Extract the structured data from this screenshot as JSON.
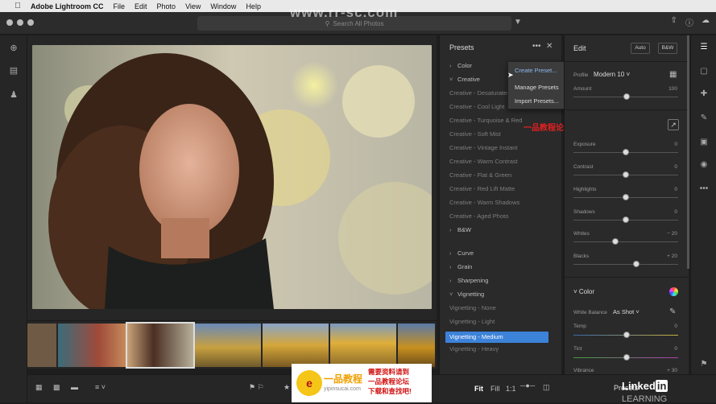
{
  "menubar": {
    "app": "Adobe Lightroom CC",
    "items": [
      "File",
      "Edit",
      "Photo",
      "View",
      "Window",
      "Help"
    ]
  },
  "watermark": "www.rr-sc.com",
  "search": {
    "placeholder": "Search All Photos"
  },
  "presets": {
    "title": "Presets",
    "items": [
      {
        "label": "Color",
        "type": "group",
        "expanded": false
      },
      {
        "label": "Creative",
        "type": "group",
        "expanded": true
      },
      {
        "label": "Creative - Desaturated",
        "type": "preset"
      },
      {
        "label": "Creative - Cool Light",
        "type": "preset"
      },
      {
        "label": "Creative - Turquoise & Red",
        "type": "preset"
      },
      {
        "label": "Creative - Soft Mist",
        "type": "preset"
      },
      {
        "label": "Creative - Vintage Instant",
        "type": "preset"
      },
      {
        "label": "Creative - Warm Contrast",
        "type": "preset"
      },
      {
        "label": "Creative - Flat & Green",
        "type": "preset"
      },
      {
        "label": "Creative - Red Lift Matte",
        "type": "preset"
      },
      {
        "label": "Creative - Warm Shadows",
        "type": "preset"
      },
      {
        "label": "Creative - Aged Photo",
        "type": "preset"
      },
      {
        "label": "B&W",
        "type": "group",
        "expanded": false
      },
      {
        "label": "Curve",
        "type": "group",
        "expanded": false
      },
      {
        "label": "Grain",
        "type": "group",
        "expanded": false
      },
      {
        "label": "Sharpening",
        "type": "group",
        "expanded": false
      },
      {
        "label": "Vignetting",
        "type": "group",
        "expanded": true
      },
      {
        "label": "Vignetting - None",
        "type": "preset"
      },
      {
        "label": "Vignetting - Light",
        "type": "preset"
      },
      {
        "label": "Vignetting - Medium",
        "type": "preset",
        "active": true
      },
      {
        "label": "Vignetting - Heavy",
        "type": "preset"
      }
    ]
  },
  "context_menu": {
    "items": [
      "Create Preset...",
      "Manage Presets",
      "Import Presets..."
    ]
  },
  "annotation": "一品教程论坛首发",
  "edit": {
    "title": "Edit",
    "auto_label": "Auto",
    "bw_label": "B&W",
    "profile_label": "Profile",
    "profile_value": "Modern 10",
    "amount": {
      "label": "Amount",
      "value": "100"
    },
    "sliders": [
      {
        "label": "Exposure",
        "value": "0",
        "pos": 0.5
      },
      {
        "label": "Contrast",
        "value": "0",
        "pos": 0.5
      },
      {
        "label": "Highlights",
        "value": "0",
        "pos": 0.5
      },
      {
        "label": "Shadows",
        "value": "0",
        "pos": 0.5
      },
      {
        "label": "Whites",
        "value": "− 20",
        "pos": 0.4
      },
      {
        "label": "Blacks",
        "value": "+ 20",
        "pos": 0.6
      }
    ],
    "color_section": "Color",
    "white_balance_label": "White Balance",
    "white_balance_value": "As Shot",
    "temp": {
      "label": "Temp",
      "value": "0",
      "pos": 0.5
    },
    "tint": {
      "label": "Tint",
      "value": "0",
      "pos": 0.5
    },
    "vibrance": {
      "label": "Vibrance",
      "value": "+ 30"
    }
  },
  "bottombar": {
    "fit": "Fit",
    "fill": "Fill",
    "ratio": "1:1",
    "presets_button": "Presets"
  },
  "promo": {
    "logo_text": "e",
    "name": "一品教程",
    "url": "yipinsucai.com",
    "line1": "需要资料请到",
    "line2": "一品教程论坛",
    "line3": "下载和查找吧!"
  },
  "linkedin": {
    "brand": "Linked",
    "in": "in",
    "learning": "LEARNING"
  },
  "colors": {
    "accent": "#3d82d9",
    "annotation": "#e02020"
  }
}
